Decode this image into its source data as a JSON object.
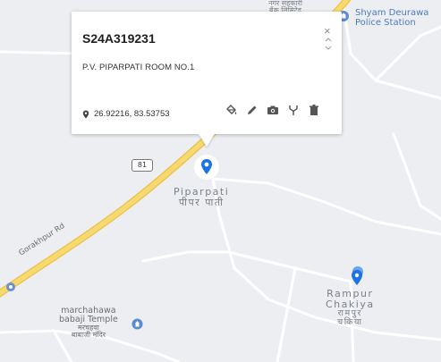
{
  "popup": {
    "title": "S24A319231",
    "address": "P.V. PIPARPATI ROOM NO.1",
    "coordinates": "26.92216, 83.53753",
    "close_symbol": "×"
  },
  "map": {
    "place_main_en": "Piparpati",
    "place_main_hi": "पीपर पाती",
    "place_2_en_line1": "Rampur",
    "place_2_en_line2": "Chakiya",
    "place_2_hi_line1": "रामपुर",
    "place_2_hi_line2": "चकिया",
    "temple_en_line1": "marchahawa",
    "temple_en_line2": "babaji Temple",
    "temple_hi_line1": "मरचहवा",
    "temple_hi_line2": "बाबाजी मंदिर",
    "police_line1": "Shyam Deurawa",
    "police_line2": "Police Station",
    "top_label_line1": "नगर सहकारी",
    "top_label_line2": "बैंक लिमिटेड",
    "road_label": "Gorakhpur Rd",
    "road_shield": "81"
  },
  "colors": {
    "marker_blue": "#1a73e8",
    "road_yellow": "#f8d96f",
    "road_border": "#e8c24a",
    "map_bg": "#eceef1",
    "poi_blue": "#4a7bc1"
  },
  "icons": {
    "fill": "paint-bucket-icon",
    "edit": "pencil-icon",
    "camera": "camera-icon",
    "fork": "fork-icon",
    "delete": "trash-icon",
    "location": "location-pin-icon"
  }
}
